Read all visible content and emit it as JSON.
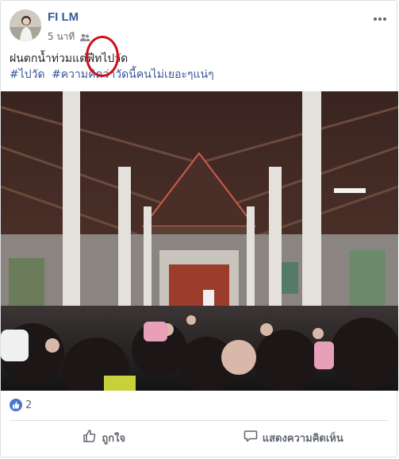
{
  "post": {
    "author": "FI LM",
    "time": "5 นาที",
    "audience_icon": "group-icon",
    "text": "ฝนตกน้ำท่วมแต่ฟีทไปวัด",
    "hashtags": [
      "#ไปวัด",
      "#ความคิดว่าวัดนี้คนไม่เยอะๆแน่ๆ"
    ],
    "annotation_color": "#d0101a"
  },
  "reactions": {
    "like_icon": "like-icon",
    "count": "2"
  },
  "actions": {
    "like_label": "ถูกใจ",
    "comment_label": "แสดงความคิดเห็น"
  },
  "colors": {
    "link": "#385898",
    "meta": "#616770",
    "like_badge": "#4a76d1"
  }
}
